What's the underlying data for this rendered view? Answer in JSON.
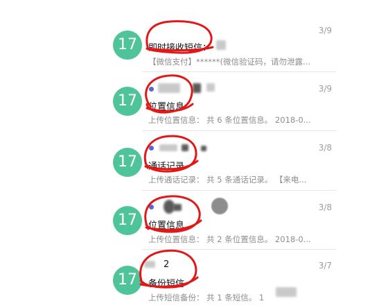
{
  "messages": [
    {
      "badge": "17",
      "title": "即时接收短信：",
      "date": "3/9",
      "preview": "【微信支付】******(微信验证码，请勿泄露...",
      "unread": false
    },
    {
      "badge": "17",
      "title": "位置信息",
      "date": "3/9",
      "preview": "上传位置信息：  共 6 条位置信息。 2018-0...",
      "unread": true
    },
    {
      "badge": "17",
      "title": "通话记录",
      "date": "3/8",
      "preview": "上传通话记录：  共 5 条通话记录。 【来电...",
      "unread": true
    },
    {
      "badge": "17",
      "title": "位置信息",
      "date": "3/8",
      "preview": "上传位置信息：  共 2 条位置信息。 2018-0...",
      "unread": true
    },
    {
      "badge": "17",
      "title": "备份短信",
      "date": "3/7",
      "preview": "上传短信备份：  共 1 条短信。 1",
      "unread": false,
      "sender": "2"
    }
  ],
  "colors": {
    "badge": "#4fc39a",
    "annotation": "#e01818",
    "unread_dot": "#5b66c9"
  }
}
